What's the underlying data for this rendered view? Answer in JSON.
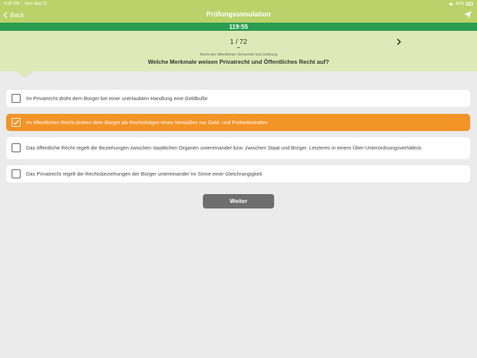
{
  "statusbar": {
    "time": "6:55 PM",
    "date": "Mon May 31",
    "battery": "64%"
  },
  "navbar": {
    "back_label": "Back",
    "title": "Prüfungssimulation"
  },
  "timer": "119:55",
  "question_header": {
    "counter": "1 / 72",
    "category": "Recht der öffentlichen Sicherheit und Ordnung",
    "question": "Welche Merkmale weisen Privatrecht und Öffentliches Recht auf?"
  },
  "answers": [
    {
      "text": "Im Privatrecht droht dem Bürger bei einer unerlaubten Handlung eine Geldbuße",
      "checked": false
    },
    {
      "text": "Im öffentlichen Recht drohen dem Bürger als Rechtsfolgen eines Verstoßes nur Geld- und Freiheitsstrafen",
      "checked": true
    },
    {
      "text": "Das öffentliche Recht regelt die Beziehungen zwischen staatlichen Organen untereinander bzw. zwischen Staat und Bürger. Letzteres in einem Über-Unterordnungsverhältnis",
      "checked": false
    },
    {
      "text": "Das Privatrecht regelt die Rechtsbeziehungen der Bürger untereinander im Sinne einer Gleichrangigkeit",
      "checked": false
    }
  ],
  "weiter_label": "Weiter",
  "colors": {
    "header_green": "#b9d36a",
    "timer_green": "#2a9d52",
    "question_bg": "#dfe9b7",
    "selected_orange": "#f39427",
    "button_gray": "#6e6e6e"
  }
}
